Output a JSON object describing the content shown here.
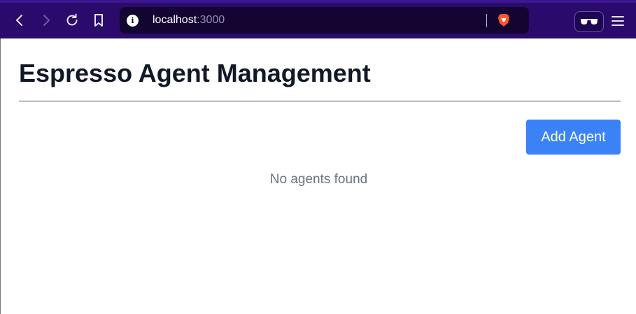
{
  "browser": {
    "url_host": "localhost",
    "url_port": ":3000",
    "info_glyph": "i",
    "icons": [
      "back-icon",
      "forward-icon",
      "reload-icon",
      "bookmark-icon",
      "info-icon",
      "brave-shield-icon",
      "private-glasses-icon",
      "hamburger-menu-icon"
    ],
    "colors": {
      "toolbar": "#2a0a6b",
      "url_bar": "#140432"
    }
  },
  "page": {
    "title": "Espresso Agent Management",
    "add_button_label": "Add Agent",
    "empty_message": "No agents found",
    "colors": {
      "primary": "#3b82f6",
      "title": "#111827",
      "muted": "#6b7280"
    }
  }
}
